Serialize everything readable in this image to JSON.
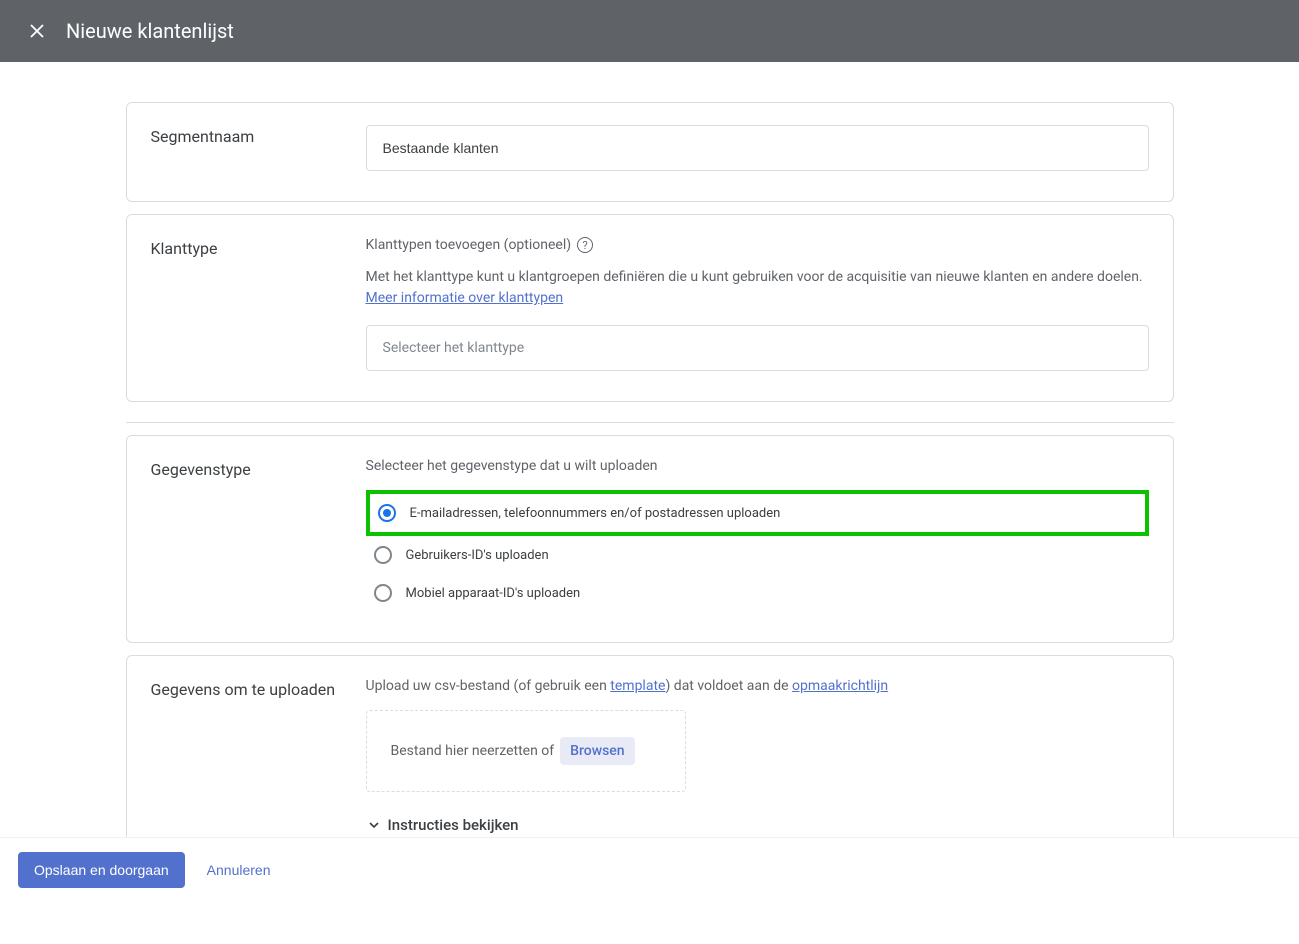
{
  "header": {
    "title": "Nieuwe klantenlijst"
  },
  "segment": {
    "label": "Segmentnaam",
    "value": "Bestaande klanten"
  },
  "clientType": {
    "label": "Klanttype",
    "addLabel": "Klanttypen toevoegen (optioneel)",
    "description": "Met het klanttype kunt u klantgroepen definiëren die u kunt gebruiken voor de acquisitie van nieuwe klanten en andere doelen. ",
    "moreInfoLink": "Meer informatie over klanttypen",
    "selectPlaceholder": "Selecteer het klanttype"
  },
  "dataType": {
    "label": "Gegevenstype",
    "heading": "Selecteer het gegevenstype dat u wilt uploaden",
    "options": [
      "E-mailadressen, telefoonnummers en/of postadressen uploaden",
      "Gebruikers-ID's uploaden",
      "Mobiel apparaat-ID's uploaden"
    ]
  },
  "uploadData": {
    "label": "Gegevens om te uploaden",
    "descPrefix": "Upload uw csv-bestand (of gebruik een ",
    "templateLink": "template",
    "descMid": ") dat voldoet aan de ",
    "formatLink": "opmaakrichtlijn",
    "dropText": "Bestand hier neerzetten of",
    "browseLabel": "Browsen",
    "instructionsLabel": "Instructies bekijken"
  },
  "footer": {
    "saveLabel": "Opslaan en doorgaan",
    "cancelLabel": "Annuleren"
  }
}
